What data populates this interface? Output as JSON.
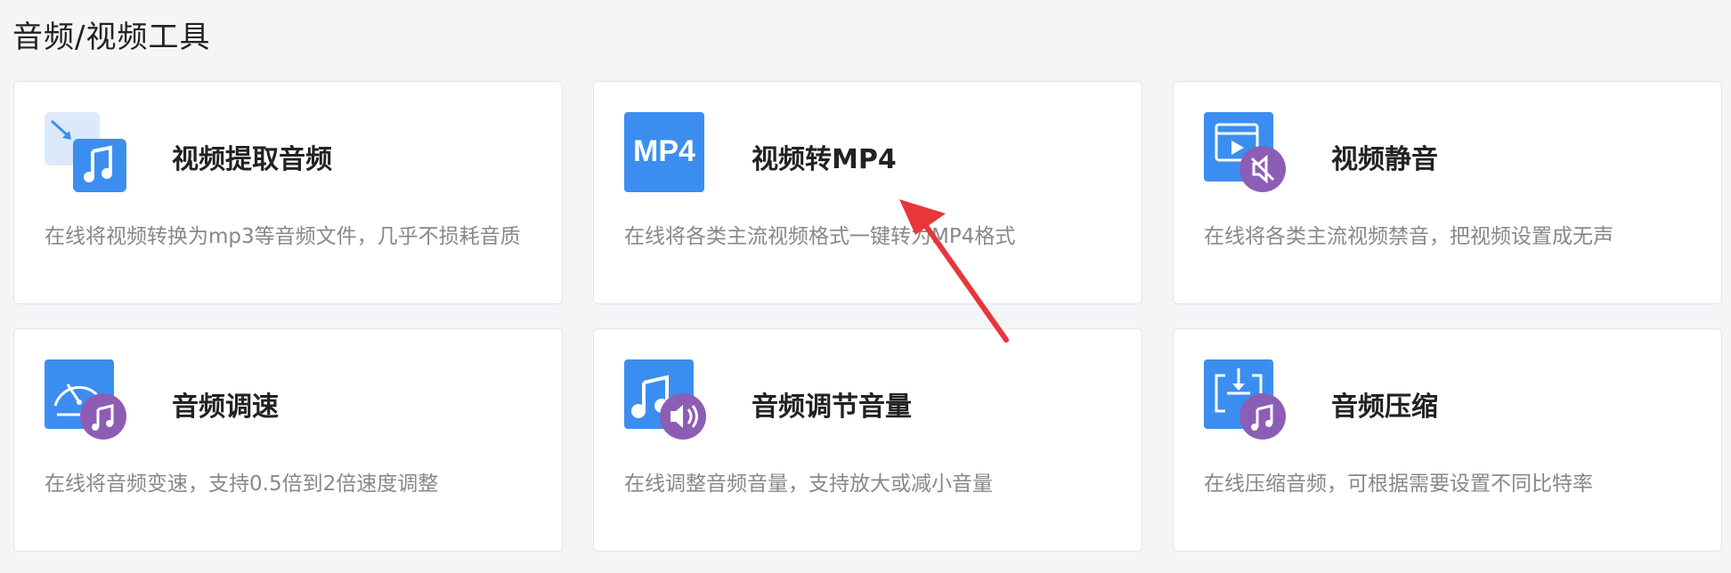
{
  "section": {
    "title": "音频/视频工具"
  },
  "cards": [
    {
      "title": "视频提取音频",
      "desc": "在线将视频转换为mp3等音频文件，几乎不损耗音质",
      "icon": "video-extract-audio-icon"
    },
    {
      "title": "视频转MP4",
      "desc": "在线将各类主流视频格式一键转为MP4格式",
      "icon": "mp4-icon",
      "icon_text": "MP4"
    },
    {
      "title": "视频静音",
      "desc": "在线将各类主流视频禁音，把视频设置成无声",
      "icon": "video-mute-icon"
    },
    {
      "title": "音频调速",
      "desc": "在线将音频变速，支持0.5倍到2倍速度调整",
      "icon": "audio-speed-icon"
    },
    {
      "title": "音频调节音量",
      "desc": "在线调整音频音量，支持放大或减小音量",
      "icon": "audio-volume-icon"
    },
    {
      "title": "音频压缩",
      "desc": "在线压缩音频，可根据需要设置不同比特率",
      "icon": "audio-compress-icon"
    }
  ],
  "colors": {
    "icon_blue": "#3b8ef0",
    "icon_purple": "#8c5db5",
    "arrow_red": "#e8363a"
  }
}
